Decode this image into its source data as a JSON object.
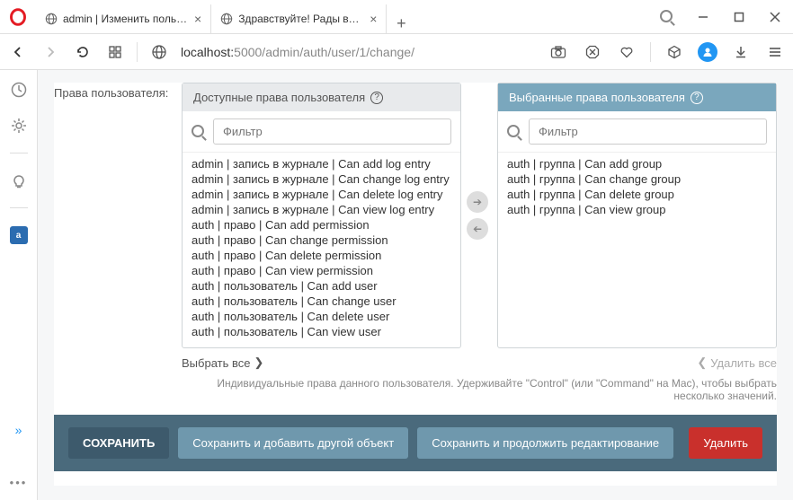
{
  "browser": {
    "tabs": [
      {
        "title": "admin | Изменить пользов",
        "active": true
      },
      {
        "title": "Здравствуйте! Рады вас в",
        "active": false
      }
    ],
    "url_prefix": "localhost:",
    "url_rest": "5000/admin/auth/user/1/change/"
  },
  "form": {
    "label": "Права пользователя:",
    "available_header": "Доступные права пользователя",
    "chosen_header": "Выбранные права пользователя",
    "filter_placeholder": "Фильтр",
    "available": [
      "admin | запись в журнале | Can add log entry",
      "admin | запись в журнале | Can change log entry",
      "admin | запись в журнале | Can delete log entry",
      "admin | запись в журнале | Can view log entry",
      "auth | право | Can add permission",
      "auth | право | Can change permission",
      "auth | право | Can delete permission",
      "auth | право | Can view permission",
      "auth | пользователь | Can add user",
      "auth | пользователь | Can change user",
      "auth | пользователь | Can delete user",
      "auth | пользователь | Can view user"
    ],
    "chosen": [
      "auth | группа | Can add group",
      "auth | группа | Can change group",
      "auth | группа | Can delete group",
      "auth | группа | Can view group"
    ],
    "choose_all": "Выбрать все",
    "remove_all": "Удалить все",
    "help": "Индивидуальные права данного пользователя. Удерживайте \"Control\" (или \"Command\" на Mac), чтобы выбрать несколько значений."
  },
  "actions": {
    "save": "СОХРАНИТЬ",
    "save_add": "Сохранить и добавить другой объект",
    "save_continue": "Сохранить и продолжить редактирование",
    "delete": "Удалить"
  }
}
